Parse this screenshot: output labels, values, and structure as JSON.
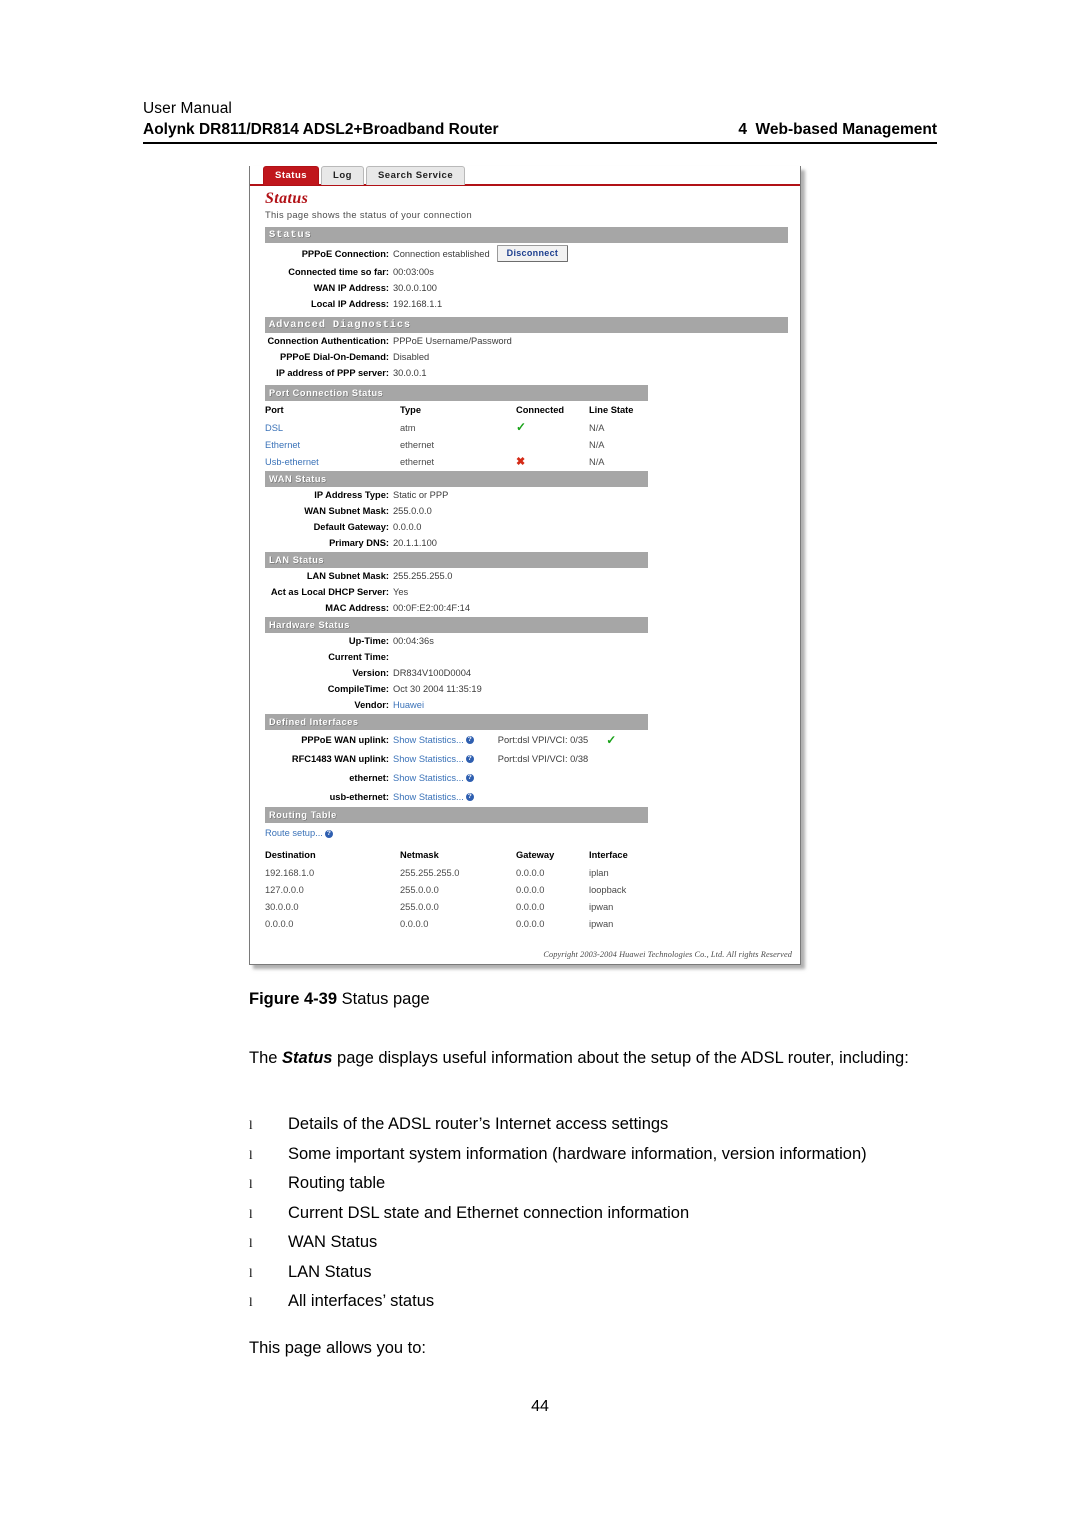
{
  "header": {
    "line1": "User Manual",
    "line2_left": "Aolynk DR811/DR814 ADSL2+Broadband Router",
    "line2_right": "4  Web-based Management"
  },
  "screenshot": {
    "tabs": [
      {
        "label": "Status",
        "active": true
      },
      {
        "label": "Log",
        "active": false
      },
      {
        "label": "Search Service",
        "active": false
      }
    ],
    "page_title": "Status",
    "page_subtitle": "This page shows the status of your connection",
    "status_section": {
      "bar": "Status",
      "rows": [
        {
          "label": "PPPoE Connection:",
          "value": "Connection established",
          "button": "Disconnect"
        },
        {
          "label": "Connected time so far:",
          "value": "00:03:00s"
        },
        {
          "label": "WAN IP Address:",
          "value": "30.0.0.100"
        },
        {
          "label": "Local IP Address:",
          "value": "192.168.1.1"
        }
      ]
    },
    "advanced_diagnostics": {
      "bar": "Advanced Diagnostics",
      "rows": [
        {
          "label": "Connection Authentication:",
          "value": "PPPoE Username/Password"
        },
        {
          "label": "PPPoE Dial-On-Demand:",
          "value": "Disabled"
        },
        {
          "label": "IP address of PPP server:",
          "value": "30.0.0.1"
        }
      ]
    },
    "port_connection_status": {
      "bar": "Port Connection Status",
      "columns": [
        "Port",
        "Type",
        "Connected",
        "Line State"
      ],
      "rows": [
        {
          "port": "DSL",
          "type": "atm",
          "connected": "yes",
          "line_state": "N/A"
        },
        {
          "port": "Ethernet",
          "type": "ethernet",
          "connected": "",
          "line_state": "N/A"
        },
        {
          "port": "Usb-ethernet",
          "type": "ethernet",
          "connected": "no",
          "line_state": "N/A"
        }
      ]
    },
    "wan_status": {
      "bar": "WAN Status",
      "rows": [
        {
          "label": "IP Address Type:",
          "value": "Static or PPP"
        },
        {
          "label": "WAN Subnet Mask:",
          "value": "255.0.0.0"
        },
        {
          "label": "Default Gateway:",
          "value": "0.0.0.0"
        },
        {
          "label": "Primary DNS:",
          "value": "20.1.1.100"
        }
      ]
    },
    "lan_status": {
      "bar": "LAN Status",
      "rows": [
        {
          "label": "LAN Subnet Mask:",
          "value": "255.255.255.0"
        },
        {
          "label": "Act as Local DHCP Server:",
          "value": "Yes"
        },
        {
          "label": "MAC Address:",
          "value": "00:0F:E2:00:4F:14"
        }
      ]
    },
    "hardware_status": {
      "bar": "Hardware Status",
      "rows": [
        {
          "label": "Up-Time:",
          "value": "00:04:36s"
        },
        {
          "label": "Current Time:",
          "value": ""
        },
        {
          "label": "Version:",
          "value": "DR834V100D0004"
        },
        {
          "label": "CompileTime:",
          "value": "Oct 30 2004 11:35:19"
        },
        {
          "label": "Vendor:",
          "value": "Huawei",
          "link": true
        }
      ]
    },
    "defined_interfaces": {
      "bar": "Defined Interfaces",
      "rows": [
        {
          "label": "PPPoE WAN uplink:",
          "stats": "Show Statistics...",
          "port": "Port:dsl VPI/VCI: 0/35",
          "port_link": "dsl",
          "ok": true
        },
        {
          "label": "RFC1483 WAN uplink:",
          "stats": "Show Statistics...",
          "port": "Port:dsl VPI/VCI: 0/38",
          "port_link": "dsl",
          "ok": false
        },
        {
          "label": "ethernet:",
          "stats": "Show Statistics...",
          "port": "",
          "ok": false
        },
        {
          "label": "usb-ethernet:",
          "stats": "Show Statistics...",
          "port": "",
          "ok": false
        }
      ]
    },
    "routing_table": {
      "bar": "Routing Table",
      "route_setup": "Route setup...",
      "columns": [
        "Destination",
        "Netmask",
        "Gateway",
        "Interface"
      ],
      "rows": [
        {
          "destination": "192.168.1.0",
          "netmask": "255.255.255.0",
          "gateway": "0.0.0.0",
          "interface": "iplan"
        },
        {
          "destination": "127.0.0.0",
          "netmask": "255.0.0.0",
          "gateway": "0.0.0.0",
          "interface": "loopback"
        },
        {
          "destination": "30.0.0.0",
          "netmask": "255.0.0.0",
          "gateway": "0.0.0.0",
          "interface": "ipwan"
        },
        {
          "destination": "0.0.0.0",
          "netmask": "0.0.0.0",
          "gateway": "0.0.0.0",
          "interface": "ipwan"
        }
      ]
    },
    "copyright": "Copyright 2003-2004 Huawei Technologies Co., Ltd. All rights Reserved"
  },
  "caption": {
    "prefix": "Figure 4-39",
    "text": "Status page"
  },
  "body": {
    "intro_before": "The ",
    "intro_bold": "Status",
    "intro_after": " page displays useful information about the setup of the ADSL router, including:",
    "bullet_marker": "l",
    "bullets": [
      "Details of the ADSL router’s Internet access settings",
      "Some important system information (hardware information, version information)",
      "Routing table",
      "Current DSL state and Ethernet connection information",
      "WAN Status",
      "LAN Status",
      "All interfaces’ status"
    ],
    "closing": "This page allows you to:"
  },
  "folio": "44",
  "colors": {
    "accent_red": "#b11116",
    "tab_active_bg": "#c0161c",
    "section_bar": "#a6a6a6",
    "link_blue": "#3a72b8",
    "ok_green": "#19a219",
    "fail_red": "#d42a16"
  }
}
